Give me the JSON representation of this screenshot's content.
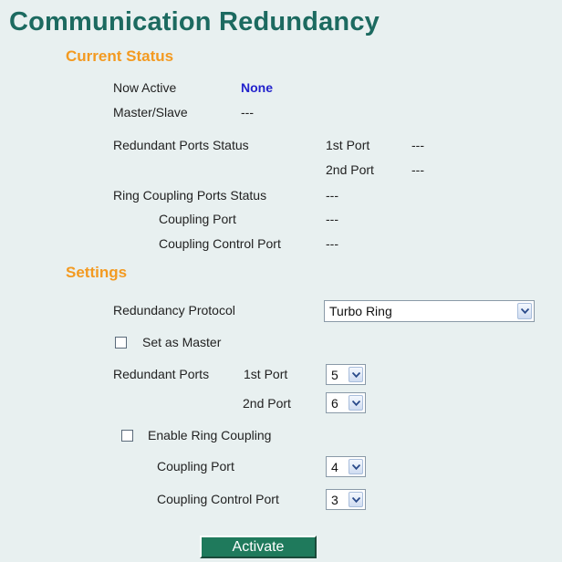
{
  "page": {
    "title": "Communication Redundancy"
  },
  "current_status": {
    "heading": "Current Status",
    "now_active_label": "Now Active",
    "now_active_value": "None",
    "master_slave_label": "Master/Slave",
    "master_slave_value": "---",
    "redundant_ports_status_label": "Redundant Ports Status",
    "first_port_label": "1st Port",
    "first_port_value": "---",
    "second_port_label": "2nd Port",
    "second_port_value": "---",
    "ring_coupling_status_label": "Ring Coupling Ports Status",
    "ring_coupling_status_value": "---",
    "coupling_port_label": "Coupling Port",
    "coupling_port_value": "---",
    "coupling_control_port_label": "Coupling Control Port",
    "coupling_control_port_value": "---"
  },
  "settings": {
    "heading": "Settings",
    "redundancy_protocol_label": "Redundancy Protocol",
    "redundancy_protocol_value": "Turbo Ring",
    "set_as_master_label": "Set as Master",
    "set_as_master_checked": false,
    "redundant_ports_label": "Redundant Ports",
    "first_port_label": "1st Port",
    "first_port_value": "5",
    "second_port_label": "2nd Port",
    "second_port_value": "6",
    "enable_ring_coupling_label": "Enable Ring Coupling",
    "enable_ring_coupling_checked": false,
    "coupling_port_label": "Coupling Port",
    "coupling_port_value": "4",
    "coupling_control_port_label": "Coupling Control Port",
    "coupling_control_port_value": "3"
  },
  "actions": {
    "activate_label": "Activate"
  },
  "colors": {
    "background": "#e8f0f0",
    "title": "#1c6a60",
    "section_heading": "#f39a21",
    "active_value": "#2222cc",
    "button": "#1f7a5c"
  }
}
